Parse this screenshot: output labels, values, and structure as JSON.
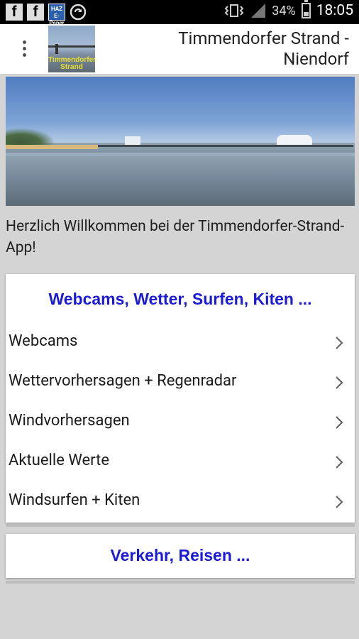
{
  "statusbar": {
    "left_icons": [
      "facebook-icon",
      "facebook-icon",
      "haz-app-icon",
      "sync-icon"
    ],
    "battery_percent": "34%",
    "time": "18:05"
  },
  "appbar": {
    "logo_text": "Timmendorfer Strand",
    "title_line1": "Timmendorfer Strand -",
    "title_line2": "Niendorf"
  },
  "welcome_text": "Herzlich Willkommen bei der Timmendorfer-Strand-App!",
  "sections": [
    {
      "title": "Webcams, Wetter, Surfen, Kiten ...",
      "items": [
        "Webcams",
        "Wettervorhersagen + Regenradar",
        "Windvorhersagen",
        "Aktuelle Werte",
        "Windsurfen + Kiten"
      ]
    },
    {
      "title": "Verkehr, Reisen ..."
    }
  ],
  "colors": {
    "accent": "#1a1ad8",
    "background": "#d4d4d4",
    "statusbar": "#000000"
  }
}
